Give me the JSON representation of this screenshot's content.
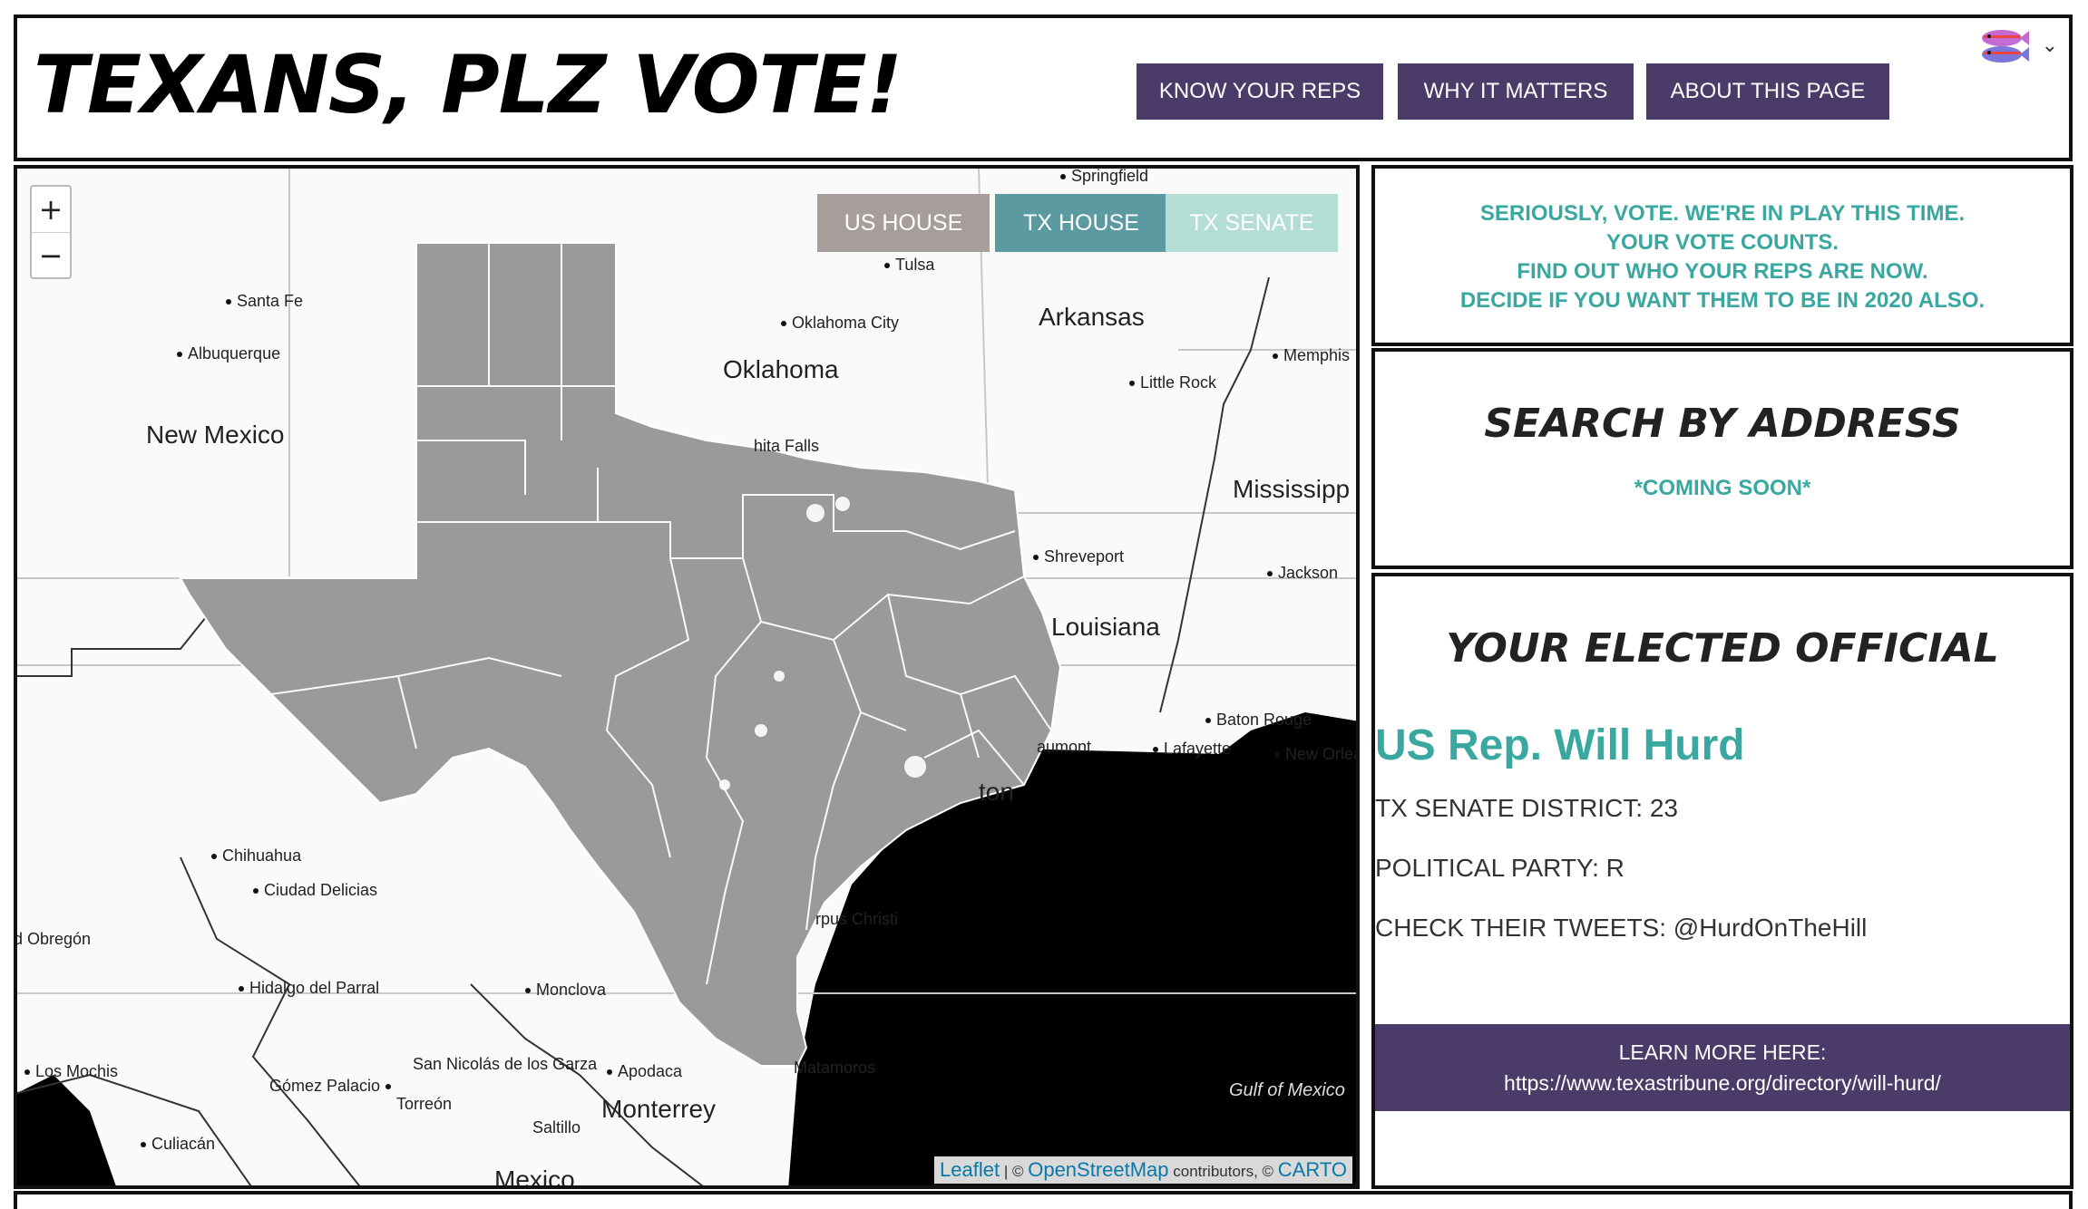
{
  "header": {
    "title": "TEXANS, PLZ VOTE!",
    "nav": [
      "KNOW YOUR REPS",
      "WHY IT MATTERS",
      "ABOUT THIS PAGE"
    ],
    "nav_color": "#4b3b68"
  },
  "map": {
    "zoom_in": "+",
    "zoom_out": "−",
    "layers": [
      "US HOUSE",
      "TX HOUSE",
      "TX SENATE"
    ],
    "layer_colors": [
      "#a79e9c",
      "#5b9aa0",
      "#b4ddd6"
    ],
    "states": [
      "New Mexico",
      "Oklahoma",
      "Arkansas",
      "Mississipp",
      "Louisiana",
      "Mexico"
    ],
    "cities": [
      "Springfield",
      "Tulsa",
      "Santa Fe",
      "Oklahoma City",
      "Albuquerque",
      "Memphis",
      "Little Rock",
      "Shreveport",
      "Jackson",
      "Baton Rouge",
      "Lafayette",
      "New Orlea",
      "aumont",
      "Chihuahua",
      "Ciudad Delicias",
      "d Obregón",
      "Hidalgo del Parral",
      "Monclova",
      "Los Mochis",
      "Gómez Palacio",
      "San Nicolás de los Garza",
      "Apodaca",
      "Torreón",
      "Saltillo",
      "Monterrey",
      "Culiacán",
      "Matamoros",
      "rpus Christi",
      "ton",
      "hita Falls"
    ],
    "water_label": "Gulf of Mexico",
    "attribution": {
      "leaflet": "Leaflet",
      "sep": " | © ",
      "osm": "OpenStreetMap",
      "contrib": " contributors, © ",
      "carto": "CARTO"
    }
  },
  "notice": {
    "lines": [
      "SERIOUSLY, VOTE. WE'RE IN PLAY THIS TIME.",
      "YOUR VOTE COUNTS.",
      "FIND OUT WHO YOUR REPS ARE NOW.",
      "DECIDE IF YOU WANT THEM TO BE IN 2020 ALSO."
    ],
    "color": "#3aa8a0"
  },
  "search": {
    "heading": "SEARCH BY ADDRESS",
    "status": "*COMING SOON*"
  },
  "official": {
    "heading": "YOUR ELECTED OFFICIAL",
    "name": "US Rep. Will Hurd",
    "district": "TX SENATE DISTRICT: 23",
    "party": "POLITICAL PARTY: R",
    "tweets": "CHECK THEIR TWEETS: @HurdOnTheHill",
    "learn_label": "LEARN MORE HERE:",
    "learn_url": "https://www.texastribune.org/directory/will-hurd/"
  }
}
